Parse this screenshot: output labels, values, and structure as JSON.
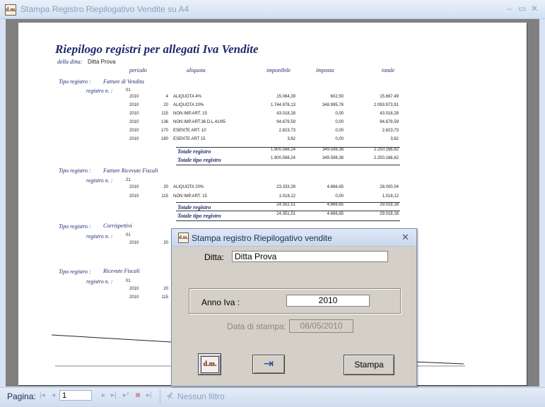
{
  "window": {
    "title": "Stampa Registro Riepilogativo Vendite su A4",
    "app_icon_text": "d.m.",
    "minimize": "–",
    "restore": "▭",
    "close": "✕"
  },
  "report": {
    "title": "Riepilogo registri per allegati Iva Vendite",
    "ditta_label": "della ditta:",
    "ditta_value": "Ditta Prova",
    "headers": {
      "periodo": "periodo",
      "aliquota": "aliquota",
      "imponibile": "imponibile",
      "imposta": "imposta",
      "totale": "totale"
    },
    "tipo_label": "Tipo registro :",
    "registro_label": "registro n. :",
    "totale_registro": "Totale registro",
    "totale_tipo": "Totale tipo registro",
    "groups": [
      {
        "tipo": "Fatture di Vendita",
        "registro": "01",
        "rows": [
          {
            "anno": "2010",
            "cod": "4",
            "aliquota": "ALIQUOTA 4%",
            "imponibile": "15.064,39",
            "imposta": "602,50",
            "totale": "15.667,49"
          },
          {
            "anno": "2010",
            "cod": "20",
            "aliquota": "ALIQUOTA 20%",
            "imponibile": "1.744.978,13",
            "imposta": "348.995,78",
            "totale": "2.093.973,91"
          },
          {
            "anno": "2010",
            "cod": "115",
            "aliquota": "NON IMP.ART. 15",
            "imponibile": "43.018,28",
            "imposta": "0,00",
            "totale": "43.018,28"
          },
          {
            "anno": "2010",
            "cod": "136",
            "aliquota": "NON IMP.ART.36 D.L.41/95",
            "imponibile": "94.679,59",
            "imposta": "0,00",
            "totale": "94.679,59"
          },
          {
            "anno": "2010",
            "cod": "170",
            "aliquota": "ESENTE ART. 10",
            "imponibile": "2.823,73",
            "imposta": "0,00",
            "totale": "2.823,73"
          },
          {
            "anno": "2010",
            "cod": "180",
            "aliquota": "ESENTE ART 15",
            "imponibile": "3,62",
            "imposta": "0,00",
            "totale": "3,62"
          }
        ],
        "tot_registro": {
          "imponibile": "1.900.568,24",
          "imposta": "349.598,38",
          "totale": "2.250.166,62"
        },
        "tot_tipo": {
          "imponibile": "1.900.568,24",
          "imposta": "349.598,38",
          "totale": "2.250.166,62"
        }
      },
      {
        "tipo": "Fatture Ricevute Fiscali",
        "registro": "21",
        "rows": [
          {
            "anno": "2010",
            "cod": "20",
            "aliquota": "ALIQUOTA 20%",
            "imponibile": "23.333,39",
            "imposta": "4.666,65",
            "totale": "28.000,04"
          },
          {
            "anno": "2010",
            "cod": "115",
            "aliquota": "NON IMP.ART. 15",
            "imponibile": "1.018,12",
            "imposta": "0,00",
            "totale": "1.018,12"
          }
        ],
        "tot_registro": {
          "imponibile": "24.351,51",
          "imposta": "4.666,65",
          "totale": "29.018,16"
        },
        "tot_tipo": {
          "imponibile": "24.351,51",
          "imposta": "4.666,65",
          "totale": "29.018,16"
        }
      },
      {
        "tipo": "Corrispettivi",
        "registro": "01",
        "rows": [
          {
            "anno": "2010",
            "cod": "20"
          }
        ]
      },
      {
        "tipo": "Ricevute Fiscali",
        "registro": "01",
        "rows": [
          {
            "anno": "2010",
            "cod": "20"
          },
          {
            "anno": "2010",
            "cod": "115"
          }
        ]
      }
    ]
  },
  "statusbar": {
    "page_label": "Pagina:",
    "page_value": "1",
    "first": "|◂",
    "prev": "◂",
    "next": "▸",
    "last": "▸|",
    "new": "▸*",
    "filter_icon": "⊀",
    "filter_label": "Nessun filtro"
  },
  "dialog": {
    "title": "Stampa registro Riepilogativo vendite",
    "close": "✕",
    "ditta_label": "Ditta:",
    "ditta_value": "Ditta Prova",
    "anno_label": "Anno Iva :",
    "anno_value": "2010",
    "data_label": "Data di stampa:",
    "data_value": "08/05/2010",
    "logo_text": "d.m.",
    "exit_icon": "⇥",
    "stampa_label": "Stampa"
  }
}
